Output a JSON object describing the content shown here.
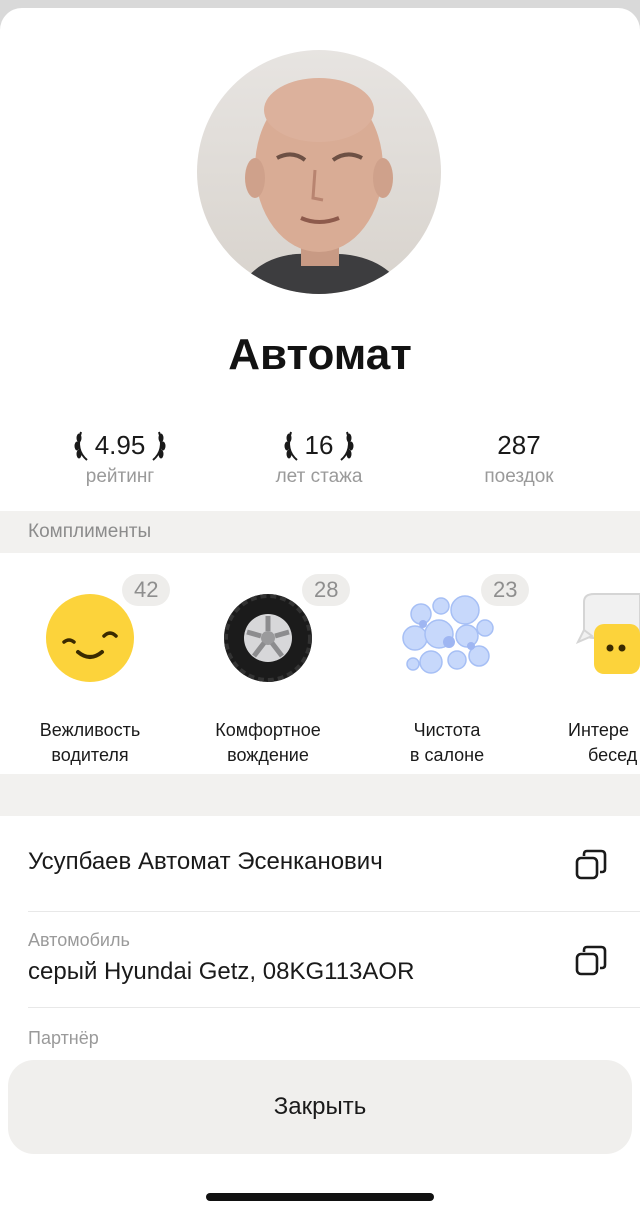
{
  "driver": {
    "name": "Автомат",
    "full_name": "Усупбаев Автомат Эсенканович"
  },
  "stats": [
    {
      "value": "4.95",
      "label": "рейтинг",
      "laurel": true
    },
    {
      "value": "16",
      "label": "лет стажа",
      "laurel": true
    },
    {
      "value": "287",
      "label": "поездок",
      "laurel": false
    }
  ],
  "compliments": {
    "title": "Комплименты",
    "items": [
      {
        "count": "42",
        "label_line1": "Вежливость",
        "label_line2": "водителя",
        "icon": "smiley-icon"
      },
      {
        "count": "28",
        "label_line1": "Комфортное",
        "label_line2": "вождение",
        "icon": "tire-icon"
      },
      {
        "count": "23",
        "label_line1": "Чистота",
        "label_line2": "в салоне",
        "icon": "bubbles-icon"
      },
      {
        "count": "",
        "label_line1": "Интере",
        "label_line2": "бесед",
        "icon": "chat-icon"
      }
    ]
  },
  "car": {
    "label": "Автомобиль",
    "value": "серый Hyundai Getz, 08KG113AOR"
  },
  "partner": {
    "label": "Партнёр"
  },
  "close_label": "Закрыть",
  "colors": {
    "accent_yellow": "#fcd33b",
    "muted_text": "#9a9a9a",
    "section_bg": "#f2f1ef"
  }
}
